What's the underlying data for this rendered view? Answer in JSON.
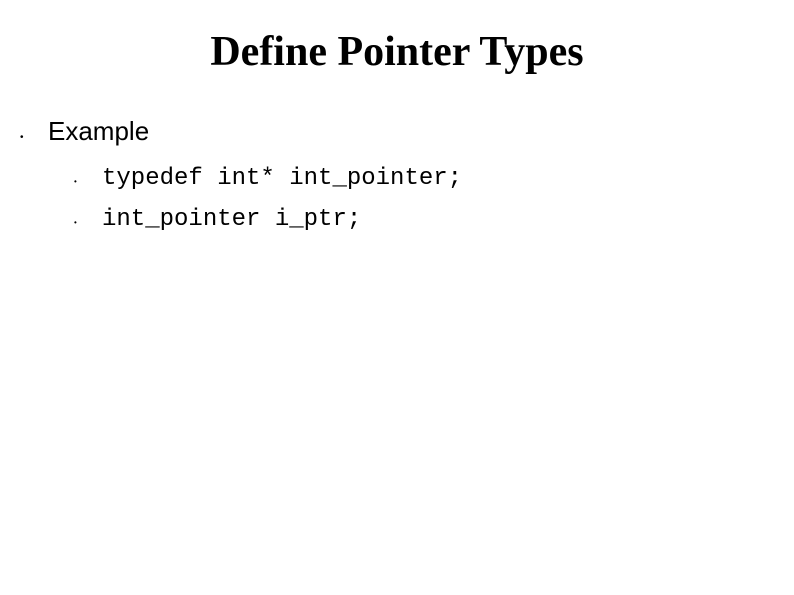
{
  "title": "Define Pointer Types",
  "section": {
    "label": "Example",
    "code_lines": [
      "typedef int* int_pointer;",
      "int_pointer i_ptr;"
    ]
  }
}
